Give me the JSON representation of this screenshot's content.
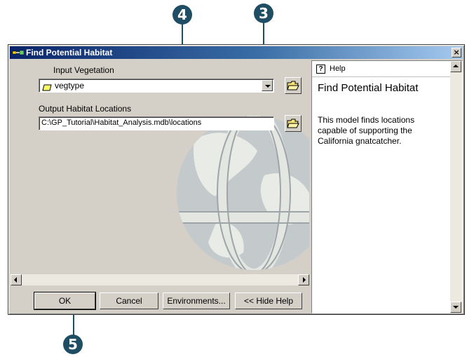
{
  "callouts": {
    "step_3": "3",
    "step_4": "4",
    "step_5": "5"
  },
  "window": {
    "title": "Find Potential Habitat"
  },
  "form": {
    "input_label": "Input Vegetation",
    "input_value": "vegtype",
    "output_label": "Output Habitat Locations",
    "output_value": "C:\\GP_Tutorial\\Habitat_Analysis.mdb\\locations"
  },
  "buttons": {
    "ok": "OK",
    "cancel": "Cancel",
    "environments": "Environments...",
    "hide_help": "<< Hide Help"
  },
  "help": {
    "header_label": "Help",
    "title": "Find Potential Habitat",
    "body": "This model finds locations capable of supporting the California gnatcatcher."
  },
  "colors": {
    "callout": "#1f4d63",
    "titlebar_start": "#0a246a",
    "dialog_face": "#d4d0c8"
  },
  "icons": {
    "combo_layer": "polygon-layer-icon",
    "browse": "open-folder-icon",
    "help": "help-book-icon",
    "app": "model-icon"
  }
}
